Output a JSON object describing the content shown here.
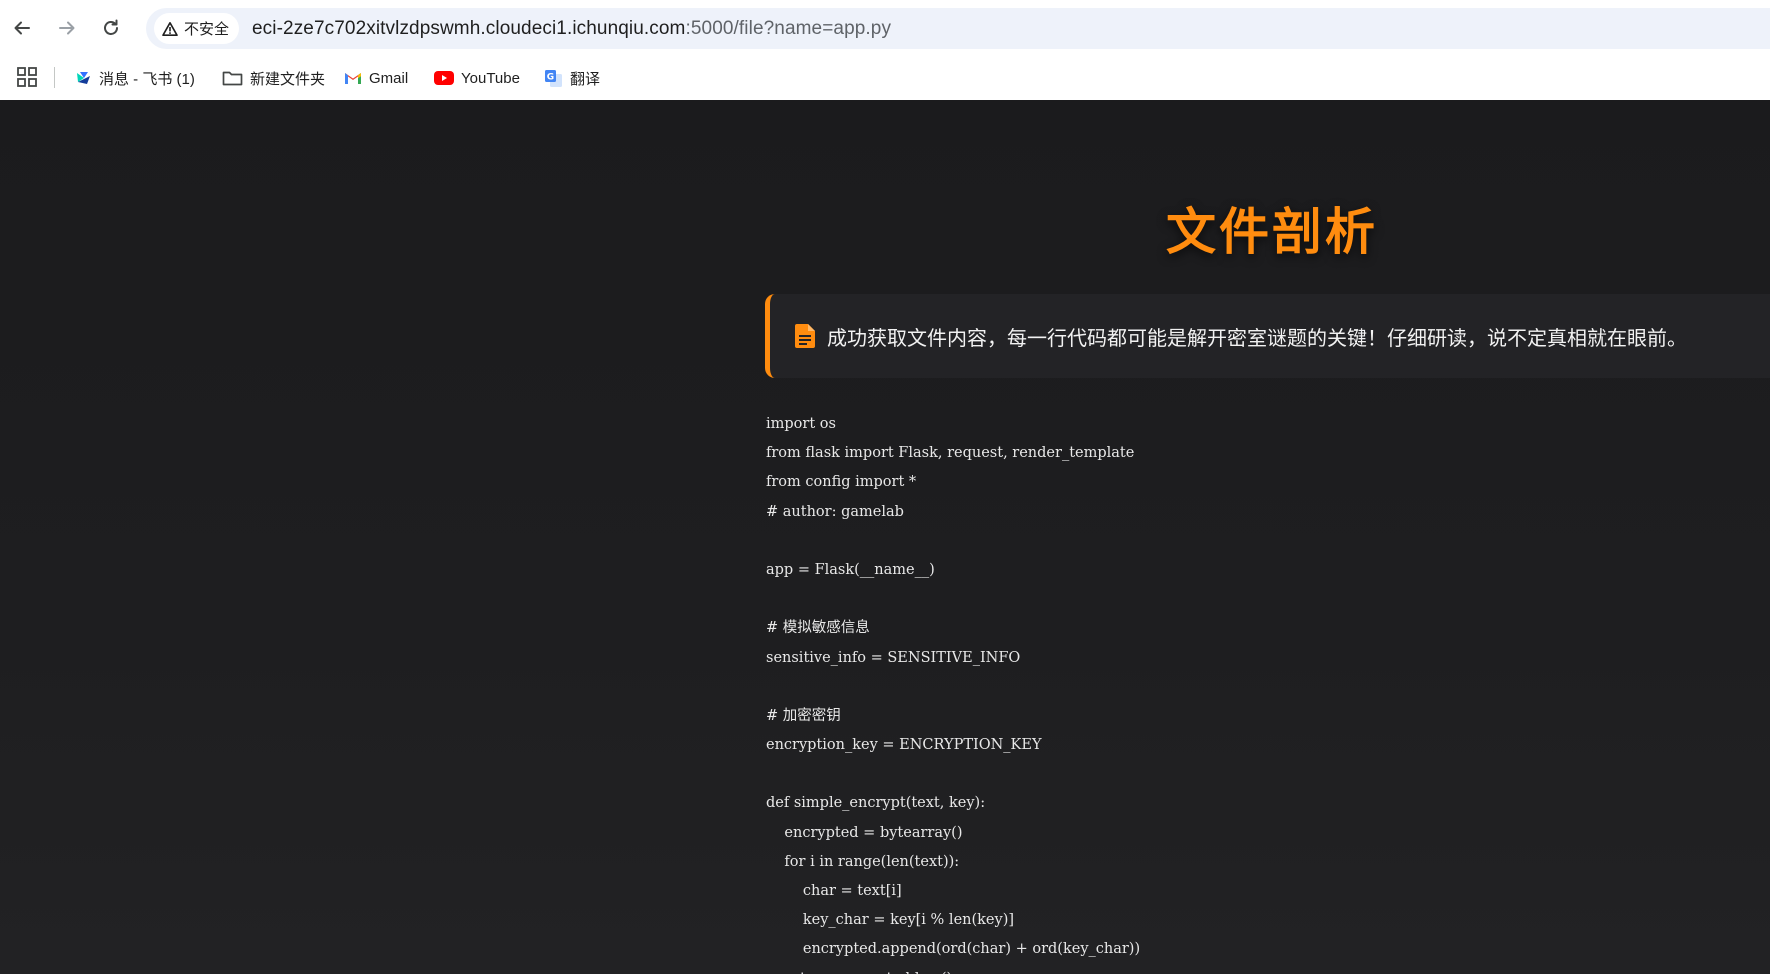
{
  "browser": {
    "security_label": "不安全",
    "url_main": "eci-2ze7c702xitvlzdpswmh.cloudeci1.ichunqiu.com",
    "url_rest": ":5000/file?name=app.py",
    "bookmarks": [
      {
        "label": "消息 - 飞书 (1)",
        "icon": "feishu-icon"
      },
      {
        "label": "新建文件夹",
        "icon": "folder-icon"
      },
      {
        "label": "Gmail",
        "icon": "gmail-icon"
      },
      {
        "label": "YouTube",
        "icon": "youtube-icon"
      },
      {
        "label": "翻译",
        "icon": "translate-icon"
      }
    ]
  },
  "page": {
    "title": "文件剖析",
    "notice": "成功获取文件内容，每一行代码都可能是解开密室谜题的关键！仔细研读，说不定真相就在眼前。",
    "accent_color": "#ff8c0f",
    "code_lines": [
      "import os",
      "from flask import Flask, request, render_template",
      "from config import *",
      "# author: gamelab",
      "",
      "app = Flask(__name__)",
      "",
      "# 模拟敏感信息",
      "sensitive_info = SENSITIVE_INFO",
      "",
      "# 加密密钥",
      "encryption_key = ENCRYPTION_KEY",
      "",
      "def simple_encrypt(text, key):",
      "    encrypted = bytearray()",
      "    for i in range(len(text)):",
      "        char = text[i]",
      "        key_char = key[i % len(key)]",
      "        encrypted.append(ord(char) + ord(key_char))",
      "    return encrypted.hex()"
    ]
  }
}
